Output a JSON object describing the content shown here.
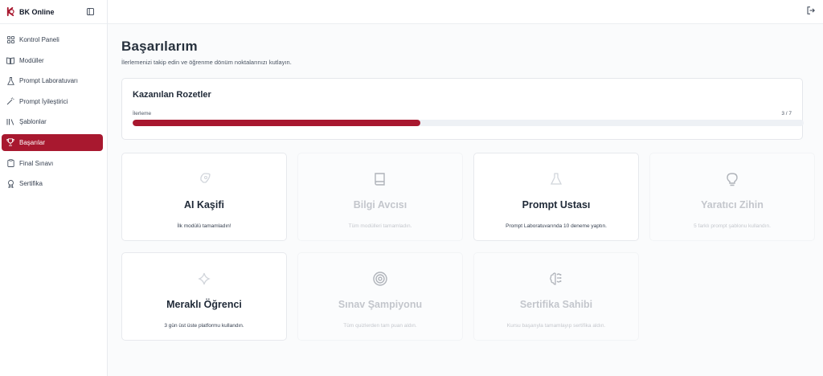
{
  "app": {
    "name": "BK Online"
  },
  "sidebar": {
    "items": [
      {
        "label": "Kontrol Paneli",
        "icon": "dashboard-icon",
        "active": false
      },
      {
        "label": "Modüller",
        "icon": "book-open-icon",
        "active": false
      },
      {
        "label": "Prompt Laboratuvarı",
        "icon": "flask-icon",
        "active": false
      },
      {
        "label": "Prompt İyileştirici",
        "icon": "magic-wand-icon",
        "active": false
      },
      {
        "label": "Şablonlar",
        "icon": "library-icon",
        "active": false
      },
      {
        "label": "Başarılar",
        "icon": "trophy-icon",
        "active": true
      },
      {
        "label": "Final Sınavı",
        "icon": "clipboard-icon",
        "active": false
      },
      {
        "label": "Sertifika",
        "icon": "award-icon",
        "active": false
      }
    ]
  },
  "page": {
    "title": "Başarılarım",
    "subtitle": "İlerlemenizi takip edin ve öğrenme dönüm noktalarınızı kutlayın."
  },
  "badges_panel": {
    "title": "Kazanılan Rozetler",
    "progress_label": "İlerleme",
    "progress_count": "3 / 7",
    "progress_fraction": 0.4286
  },
  "badges": [
    {
      "title": "AI Kaşifi",
      "desc": "İlk modülü tamamladın!",
      "icon": "rocket-icon",
      "earned": true
    },
    {
      "title": "Bilgi Avcısı",
      "desc": "Tüm modülleri tamamladın.",
      "icon": "book-icon",
      "earned": false
    },
    {
      "title": "Prompt Ustası",
      "desc": "Prompt Laboratuvarında 10 deneme yaptın.",
      "icon": "flask-icon",
      "earned": true
    },
    {
      "title": "Yaratıcı Zihin",
      "desc": "5 farklı prompt şablonu kullandın.",
      "icon": "lightbulb-icon",
      "earned": false
    },
    {
      "title": "Meraklı Öğrenci",
      "desc": "3 gün üst üste platformu kullandın.",
      "icon": "sparkle-icon",
      "earned": true
    },
    {
      "title": "Sınav Şampiyonu",
      "desc": "Tüm quizlerden tam puan aldın.",
      "icon": "target-icon",
      "earned": false
    },
    {
      "title": "Sertifika Sahibi",
      "desc": "Kursu başarıyla tamamlayıp sertifika aldın.",
      "icon": "brain-icon",
      "earned": false
    }
  ],
  "colors": {
    "accent": "#a8182f",
    "background": "#fafbfc",
    "card": "#ffffff"
  }
}
